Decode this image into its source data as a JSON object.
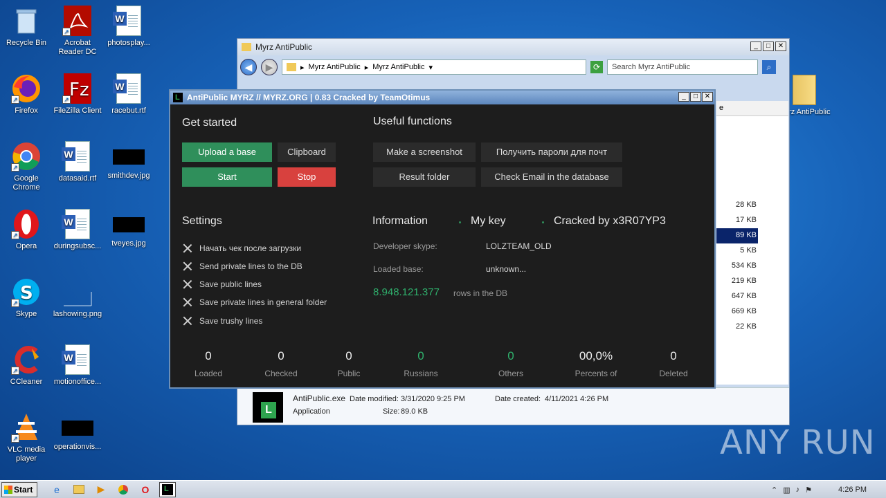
{
  "desktop": {
    "icons": [
      {
        "label": "Recycle Bin"
      },
      {
        "label": "Acrobat Reader DC"
      },
      {
        "label": "photosplay..."
      },
      {
        "label": "Firefox"
      },
      {
        "label": "FileZilla Client"
      },
      {
        "label": "racebut.rtf"
      },
      {
        "label": "Google Chrome"
      },
      {
        "label": "datasaid.rtf"
      },
      {
        "label": "smithdev.jpg"
      },
      {
        "label": "Opera"
      },
      {
        "label": "duringsubsc..."
      },
      {
        "label": "tveyes.jpg"
      },
      {
        "label": "Skype"
      },
      {
        "label": "lashowing.png"
      },
      {
        "label": "CCleaner"
      },
      {
        "label": "motionoffice..."
      },
      {
        "label": "VLC media player"
      },
      {
        "label": "operationvis..."
      },
      {
        "label": "Myrz AntiPublic"
      }
    ]
  },
  "explorer": {
    "title": "Myrz AntiPublic",
    "breadcrumb": [
      "Myrz AntiPublic",
      "Myrz AntiPublic"
    ],
    "search_placeholder": "Search Myrz AntiPublic",
    "sizes": [
      "28 KB",
      "17 KB",
      "89 KB",
      "5 KB",
      "534 KB",
      "219 KB",
      "647 KB",
      "669 KB",
      "22 KB"
    ],
    "details": {
      "name": "AntiPublic.exe",
      "modified_label": "Date modified:",
      "modified": "3/31/2020 9:25 PM",
      "created_label": "Date created:",
      "created": "4/11/2021 4:26 PM",
      "type": "Application",
      "size_label": "Size:",
      "size": "89.0 KB"
    }
  },
  "antipublic": {
    "title": "AntiPublic MYRZ // MYRZ.ORG | 0.83 Cracked by TeamOtimus",
    "get_started": "Get started",
    "upload": "Upload a base",
    "clipboard": "Clipboard",
    "start": "Start",
    "stop": "Stop",
    "useful": "Useful functions",
    "screenshot": "Make a screenshot",
    "get_passwords": "Получить пароли для почт",
    "result_folder": "Result folder",
    "check_email": "Check Email in the database",
    "settings_title": "Settings",
    "settings": [
      "Начать чек после загрузки",
      "Send private lines to the DB",
      "Save public lines",
      "Save private lines in general folder",
      "Save trushy lines"
    ],
    "info_title": "Information",
    "my_key": "My key",
    "cracked_by": "Cracked by x3R07YP3",
    "dev_skype_label": "Developer skype:",
    "dev_skype": "LOLZTEAM_OLD",
    "loaded_base_label": "Loaded base:",
    "loaded_base": "unknown...",
    "rows_count": "8.948.121.377",
    "rows_label": "rows in the DB",
    "stats": [
      {
        "num": "0",
        "cap": "Loaded"
      },
      {
        "num": "0",
        "cap": "Checked"
      },
      {
        "num": "0",
        "cap": "Public"
      },
      {
        "num": "0",
        "cap": "Russians"
      },
      {
        "num": "0",
        "cap": "Others"
      },
      {
        "num": "00,0%",
        "cap": "Percents of"
      },
      {
        "num": "0",
        "cap": "Deleted"
      }
    ]
  },
  "watermark": "ANY RUN",
  "taskbar": {
    "start": "Start",
    "time": "4:26 PM"
  }
}
